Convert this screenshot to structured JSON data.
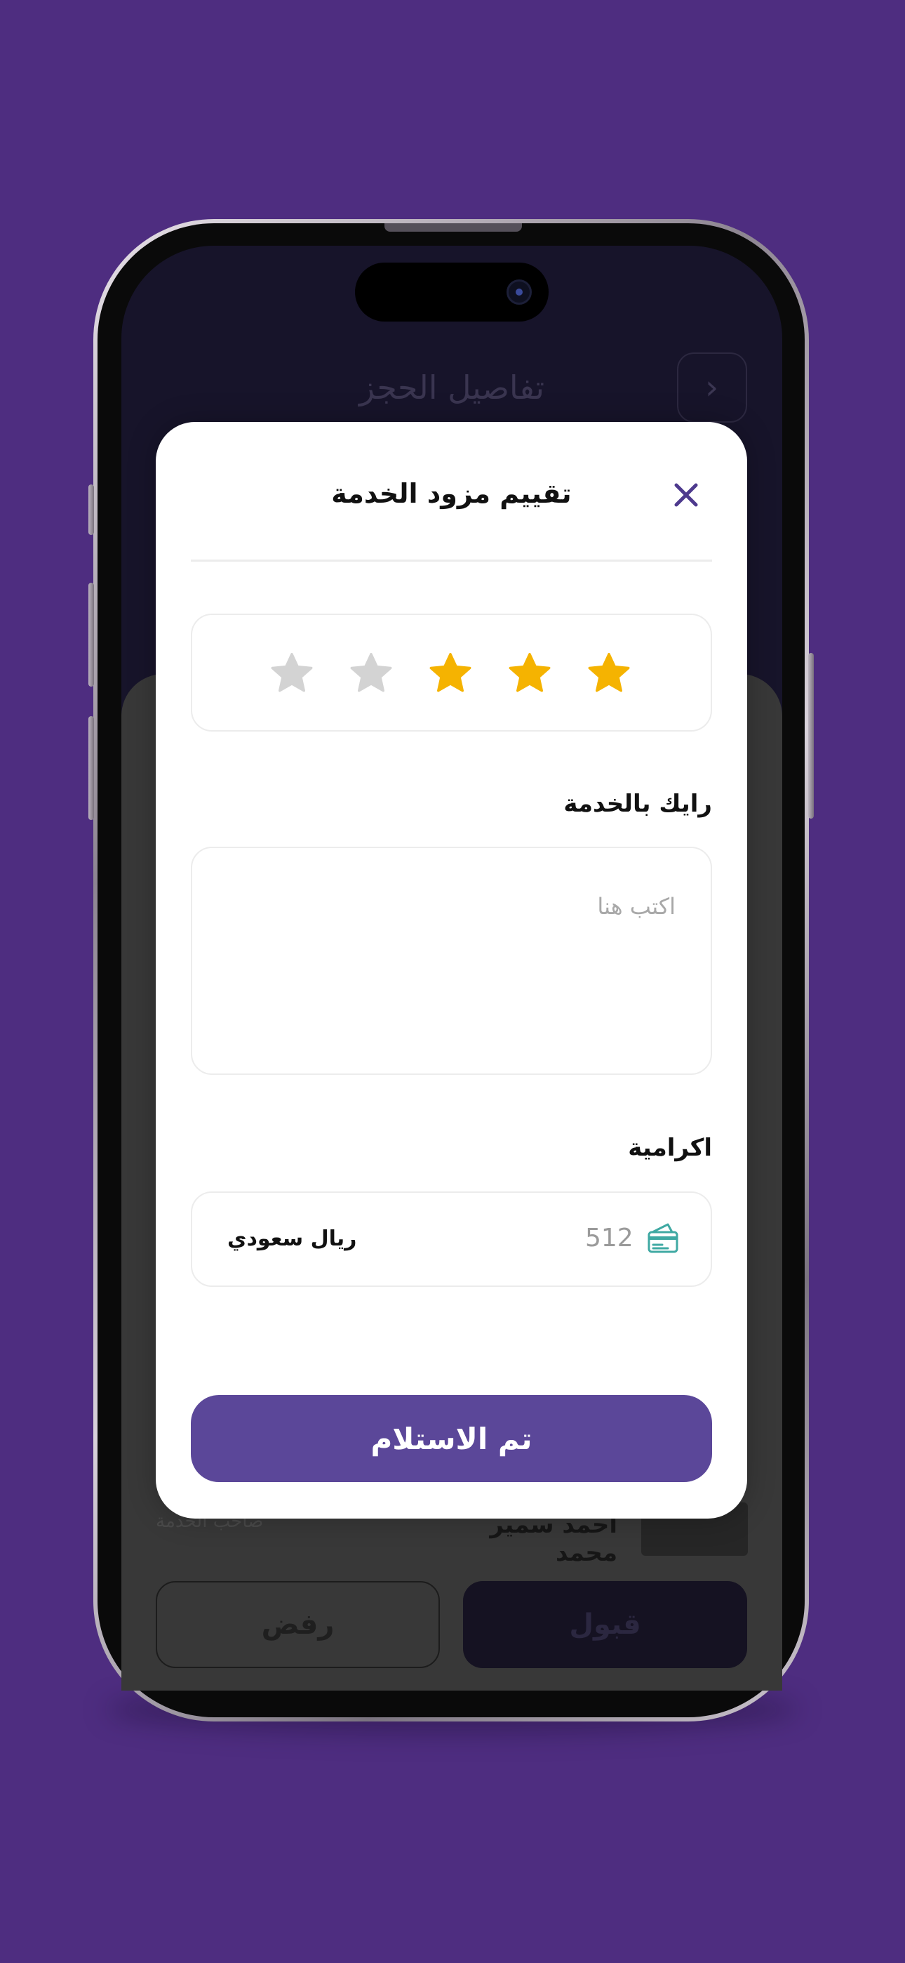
{
  "background_screen": {
    "title": "تفاصيل الحجز",
    "back_glyph": "‹",
    "provider_name": "احمد سمير محمد",
    "provider_subtitle": "صاحب الخدمة",
    "accept_label": "قبول",
    "reject_label": "رفض"
  },
  "modal": {
    "title": "تقييم مزود الخدمة",
    "close_icon": "close-icon",
    "rating": {
      "value": 3,
      "max": 5,
      "filled_color": "#F5B301",
      "empty_color": "#D3D3D3"
    },
    "review": {
      "label": "رايك بالخدمة",
      "placeholder": "اكتب هنا"
    },
    "tip": {
      "label": "اكرامية",
      "amount": "512",
      "currency": "ريال سعودي",
      "icon": "cash-icon"
    },
    "submit_label": "تم الاستلام"
  },
  "colors": {
    "page_background": "#4E2D80",
    "accent": "#5B4799",
    "close_icon": "#4E3A8E"
  }
}
